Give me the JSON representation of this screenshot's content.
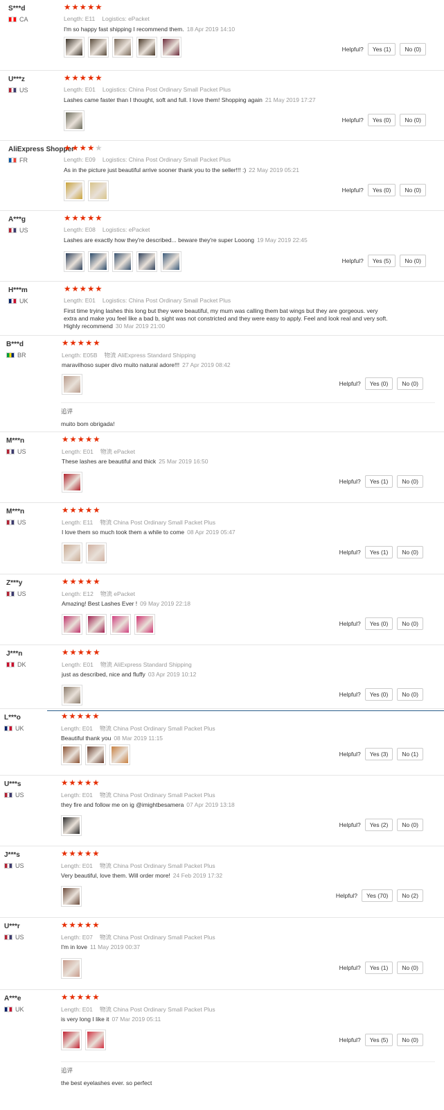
{
  "helpful_label": "Helpful?",
  "meta_length_label": "Length:",
  "followup_label": "追评",
  "reviews": [
    {
      "name": "S***d",
      "country": "CA",
      "flag": [
        "#ff0000",
        "#ffffff",
        "#ff0000"
      ],
      "rating": 5,
      "length": "E11",
      "logistics_label": "Logistics:",
      "logistics": "ePacket",
      "text": "I'm so happy fast shipping I recommend them.",
      "date": "18 Apr 2019 14:10",
      "yes": "Yes (1)",
      "no": "No (0)",
      "thumbs": [
        "#3a3228",
        "#5a4c3c",
        "#7a6a5a",
        "#4a3a2a",
        "#6b2a3a"
      ]
    },
    {
      "name": "U***z",
      "country": "US",
      "flag": [
        "#b22234",
        "#ffffff",
        "#3c3b6e"
      ],
      "rating": 5,
      "length": "E01",
      "logistics_label": "Logistics:",
      "logistics": "China Post Ordinary Small Packet Plus",
      "text": "Lashes came faster than I thought, soft and full. I love them! Shopping again",
      "date": "21 May 2019 17:27",
      "yes": "Yes (0)",
      "no": "No (0)",
      "thumbs": [
        "#6a6a5a"
      ]
    },
    {
      "name": "AliExpress Shopper",
      "country": "FR",
      "flag": [
        "#0055a4",
        "#ffffff",
        "#ef4135"
      ],
      "rating": 4,
      "length": "E09",
      "logistics_label": "Logistics:",
      "logistics": "China Post Ordinary Small Packet Plus",
      "text": "As in the picture just beautiful arrive sooner thank you to the seller!!! :)",
      "date": "22 May 2019 05:21",
      "yes": "Yes (0)",
      "no": "No (0)",
      "thumbs": [
        "#c9a33a",
        "#d8c48a"
      ]
    },
    {
      "name": "A***g",
      "country": "US",
      "flag": [
        "#b22234",
        "#ffffff",
        "#3c3b6e"
      ],
      "rating": 5,
      "length": "E08",
      "logistics_label": "Logistics:",
      "logistics": "ePacket",
      "text": "Lashes are exactly how they're described... beware they're super Looong",
      "date": "19 May 2019 22:45",
      "yes": "Yes (5)",
      "no": "No (0)",
      "thumbs": [
        "#2a3e5a",
        "#2a4a6a",
        "#34506e",
        "#2e405a",
        "#3a5a7a"
      ]
    },
    {
      "name": "H***m",
      "country": "UK",
      "flag": [
        "#012169",
        "#ffffff",
        "#c8102e"
      ],
      "rating": 5,
      "length": "E01",
      "logistics_label": "Logistics:",
      "logistics": "China Post Ordinary Small Packet Plus",
      "text": "First time trying lashes this long but they were beautiful, my mum was calling them bat wings but they are gorgeous. very extra and make you feel like a bad b, sight was not constricted and they were easy to apply. Feel and look real and very soft. Highly recommend",
      "date": "30 Mar 2019 21:00",
      "yes": "",
      "no": "",
      "thumbs": []
    },
    {
      "name": "B***d",
      "country": "BR",
      "flag": [
        "#009c3b",
        "#ffdf00",
        "#002776"
      ],
      "rating": 5,
      "length": "E05B",
      "logistics_label": "物流",
      "logistics": "AliExpress Standard Shipping",
      "text": "maravilhoso super divo muito natural adore!!!",
      "date": "27 Apr 2019 08:42",
      "yes": "Yes (0)",
      "no": "No (0)",
      "thumbs": [
        "#b89a8a"
      ],
      "followup": "muito bom obrigada!"
    },
    {
      "name": "M***n",
      "country": "US",
      "flag": [
        "#b22234",
        "#ffffff",
        "#3c3b6e"
      ],
      "rating": 5,
      "length": "E01",
      "logistics_label": "物流",
      "logistics": "ePacket",
      "text": "These lashes are beautiful and thick",
      "date": "25 Mar 2019 16:50",
      "yes": "Yes (1)",
      "no": "No (0)",
      "thumbs": [
        "#b0202a"
      ]
    },
    {
      "name": "M***n",
      "country": "US",
      "flag": [
        "#b22234",
        "#ffffff",
        "#3c3b6e"
      ],
      "rating": 5,
      "length": "E11",
      "logistics_label": "物流",
      "logistics": "China Post Ordinary Small Packet Plus",
      "text": "I love them so much took them a while to come",
      "date": "08 Apr 2019 05:47",
      "yes": "Yes (1)",
      "no": "No (0)",
      "thumbs": [
        "#c8a890",
        "#d0b0a0"
      ]
    },
    {
      "name": "Z***y",
      "country": "US",
      "flag": [
        "#b22234",
        "#ffffff",
        "#3c3b6e"
      ],
      "rating": 5,
      "length": "E12",
      "logistics_label": "物流",
      "logistics": "ePacket",
      "text": "Amazing! Best Lashes Ever !",
      "date": "09 May 2019 22:18",
      "yes": "Yes (0)",
      "no": "No (0)",
      "thumbs": [
        "#c0306a",
        "#a02050",
        "#d04080",
        "#d03070"
      ]
    },
    {
      "name": "J***n",
      "country": "DK",
      "flag": [
        "#c8102e",
        "#ffffff",
        "#c8102e"
      ],
      "rating": 5,
      "length": "E01",
      "logistics_label": "物流",
      "logistics": "AliExpress Standard Shipping",
      "text": "just as described, nice and fluffy",
      "date": "03 Apr 2019 10:12",
      "yes": "Yes (0)",
      "no": "No (0)",
      "thumbs": [
        "#8a7a6a"
      ]
    },
    {
      "name": "L***o",
      "country": "UK",
      "flag": [
        "#012169",
        "#ffffff",
        "#c8102e"
      ],
      "rating": 5,
      "length": "E01",
      "logistics_label": "物流",
      "logistics": "China Post Ordinary Small Packet Plus",
      "text": "Beautiful thank you",
      "date": "08 Mar 2019 11:15",
      "yes": "Yes (3)",
      "no": "No (1)",
      "thumbs": [
        "#8a5030",
        "#6a4030",
        "#c88040"
      ]
    },
    {
      "name": "U***s",
      "country": "US",
      "flag": [
        "#b22234",
        "#ffffff",
        "#3c3b6e"
      ],
      "rating": 5,
      "length": "E01",
      "logistics_label": "物流",
      "logistics": "China Post Ordinary Small Packet Plus",
      "text": "they fire and follow me on ig @imightbesamera",
      "date": "07 Apr 2019 13:18",
      "yes": "Yes (2)",
      "no": "No (0)",
      "thumbs": [
        "#2a2a2a"
      ]
    },
    {
      "name": "J***s",
      "country": "US",
      "flag": [
        "#b22234",
        "#ffffff",
        "#3c3b6e"
      ],
      "rating": 5,
      "length": "E01",
      "logistics_label": "物流",
      "logistics": "China Post Ordinary Small Packet Plus",
      "text": "Very beautiful, love them. Will order more!",
      "date": "24 Feb 2019 17:32",
      "yes": "Yes (70)",
      "no": "No (2)",
      "thumbs": [
        "#6a4a3a"
      ]
    },
    {
      "name": "U***r",
      "country": "US",
      "flag": [
        "#b22234",
        "#ffffff",
        "#3c3b6e"
      ],
      "rating": 5,
      "length": "E07",
      "logistics_label": "物流",
      "logistics": "China Post Ordinary Small Packet Plus",
      "text": "I'm in love",
      "date": "11 May 2019 00:37",
      "yes": "Yes (1)",
      "no": "No (0)",
      "thumbs": [
        "#c89a8a"
      ]
    },
    {
      "name": "A***e",
      "country": "UK",
      "flag": [
        "#012169",
        "#ffffff",
        "#c8102e"
      ],
      "rating": 5,
      "length": "E01",
      "logistics_label": "物流",
      "logistics": "China Post Ordinary Small Packet Plus",
      "text": "is very long I like it",
      "date": "07 Mar 2019 05:11",
      "yes": "Yes (5)",
      "no": "No (0)",
      "thumbs": [
        "#c02030",
        "#d03040"
      ],
      "followup": "the best eyelashes ever. so perfect"
    }
  ]
}
